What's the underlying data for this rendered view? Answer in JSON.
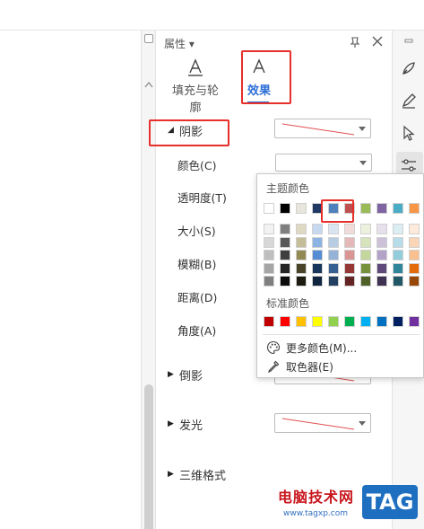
{
  "panel": {
    "title": "属性",
    "tabs": [
      {
        "label": "填充与轮廓",
        "active": false
      },
      {
        "label": "效果",
        "active": true
      }
    ]
  },
  "shadow_section": {
    "label": "阴影",
    "rows": [
      {
        "label": "颜色(C)"
      },
      {
        "label": "透明度(T)"
      },
      {
        "label": "大小(S)"
      },
      {
        "label": "模糊(B)"
      },
      {
        "label": "距离(D)"
      },
      {
        "label": "角度(A)"
      }
    ]
  },
  "sections": [
    {
      "label": "倒影"
    },
    {
      "label": "发光"
    },
    {
      "label": "三维格式"
    }
  ],
  "color_popup": {
    "theme_heading": "主题颜色",
    "standard_heading": "标准颜色",
    "theme_row": [
      "#ffffff",
      "#000000",
      "#e8e6dc",
      "#1f3864",
      "#4f81bd",
      "#c0504d",
      "#9bbb59",
      "#8064a2",
      "#4bacc6",
      "#f79646"
    ],
    "theme_shades": [
      [
        "#f2f2f2",
        "#7f7f7f",
        "#ddd9c3",
        "#c6d9f0",
        "#dbe5f1",
        "#f2dcdb",
        "#ebf1dd",
        "#e5e0ec",
        "#dbeef3",
        "#fdeada"
      ],
      [
        "#d8d8d8",
        "#595959",
        "#c4bd97",
        "#8db3e2",
        "#b8cce4",
        "#e5b9b7",
        "#d7e3bc",
        "#ccc1d9",
        "#b7dde8",
        "#fbd5b5"
      ],
      [
        "#bfbfbf",
        "#3f3f3f",
        "#938953",
        "#548dd4",
        "#95b3d7",
        "#d99694",
        "#c3d69b",
        "#b2a2c7",
        "#92cddc",
        "#fac08f"
      ],
      [
        "#a5a5a5",
        "#262626",
        "#494429",
        "#17365d",
        "#366092",
        "#953734",
        "#76923c",
        "#5f497a",
        "#31859b",
        "#e36c09"
      ],
      [
        "#7f7f7f",
        "#0c0c0c",
        "#1d1b10",
        "#0f243e",
        "#244061",
        "#632423",
        "#4f6128",
        "#3f3151",
        "#205867",
        "#974806"
      ]
    ],
    "standard_row": [
      "#c00000",
      "#ff0000",
      "#ffc000",
      "#ffff00",
      "#92d050",
      "#00b050",
      "#00b0f0",
      "#0070c0",
      "#002060",
      "#7030a0"
    ],
    "more_colors": "更多颜色(M)...",
    "eyedropper": "取色器(E)"
  },
  "watermark": {
    "site_name": "电脑技术网",
    "url": "www.tagxp.com",
    "tag": "TAG"
  },
  "colors": {
    "accent": "#2d6fd6",
    "highlight": "#e5302b"
  }
}
